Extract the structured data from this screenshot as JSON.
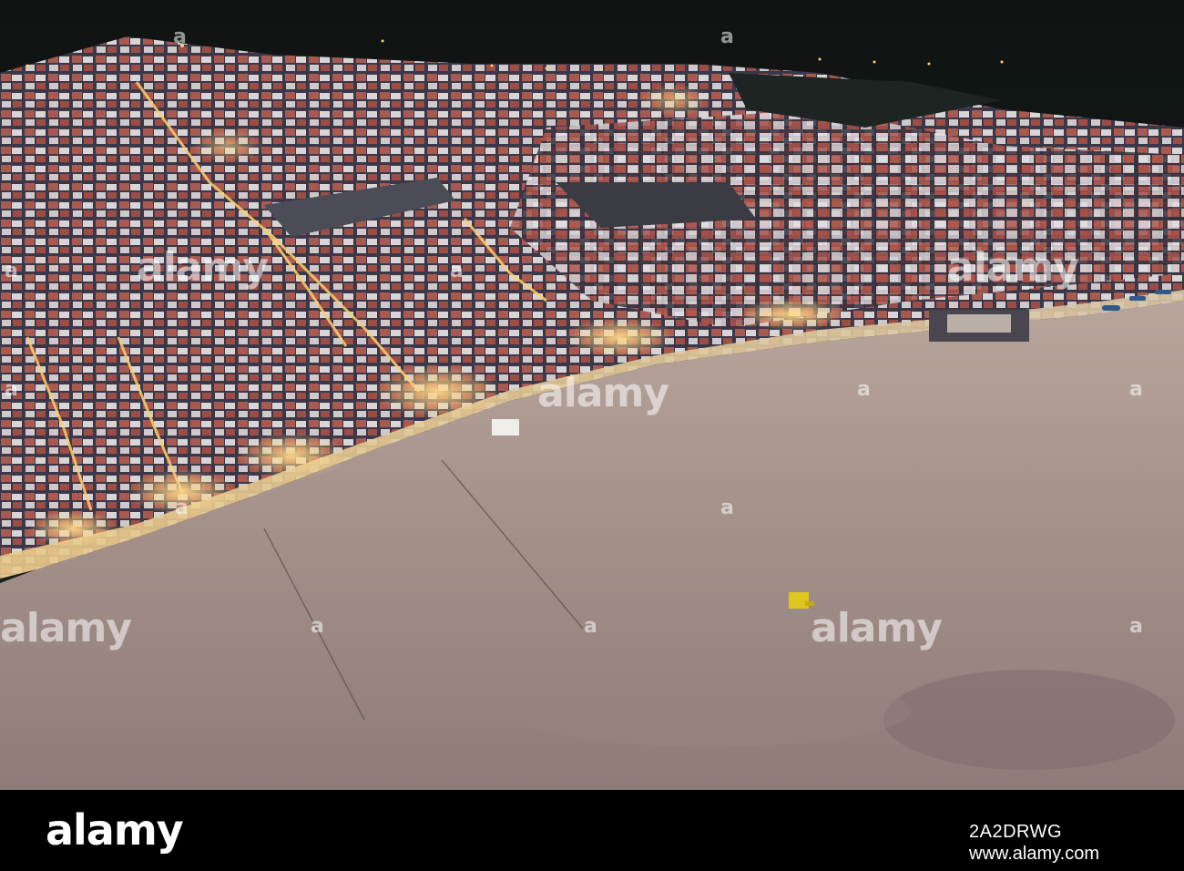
{
  "watermark": {
    "text": "alamy",
    "mark": "a"
  },
  "footer": {
    "logo": "alamy",
    "image_id": "2A2DRWG",
    "url": "www.alamy.com"
  },
  "scene_colors": {
    "sand": "#a8968f",
    "town_dark": "#2b2a36",
    "street_light": "#ffd27a",
    "roof": "#b0584c"
  }
}
